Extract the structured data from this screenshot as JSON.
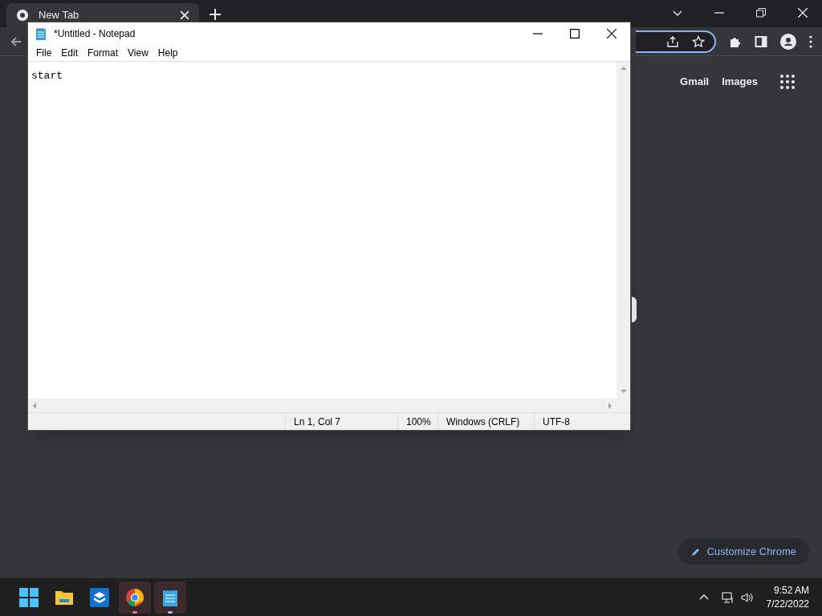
{
  "browser": {
    "tabs": [
      {
        "title": "New Tab",
        "selected": true
      }
    ],
    "links": [
      "Gmail",
      "Images"
    ],
    "customize_button": "Customize Chrome"
  },
  "notepad": {
    "title": "*Untitled - Notepad",
    "menu": [
      "File",
      "Edit",
      "Format",
      "View",
      "Help"
    ],
    "text": "start",
    "status": [
      "Ln 1, Col 7",
      "100%",
      "Windows (CRLF)",
      "UTF-8"
    ]
  },
  "taskbar": {
    "apps": [
      {
        "kind": "start",
        "running": false
      },
      {
        "kind": "folder",
        "running": false
      },
      {
        "kind": "box",
        "running": false
      },
      {
        "kind": "chrome",
        "running": true
      },
      {
        "kind": "notepad",
        "running": true
      }
    ],
    "time": "9:52 AM",
    "date": "7/22/2022"
  }
}
